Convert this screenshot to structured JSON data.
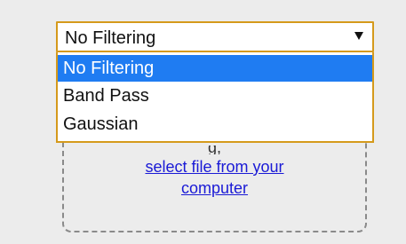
{
  "filter_select": {
    "selected": "No Filtering",
    "options": [
      "No Filtering",
      "Band Pass",
      "Gaussian"
    ]
  },
  "upload": {
    "partial_text": "g,",
    "link_text": "select file from your computer"
  },
  "colors": {
    "select_border": "#d59a1c",
    "highlight": "#1f7cf2",
    "link": "#1a1ad6"
  },
  "icons": {
    "dropdown": "triangle-down"
  }
}
